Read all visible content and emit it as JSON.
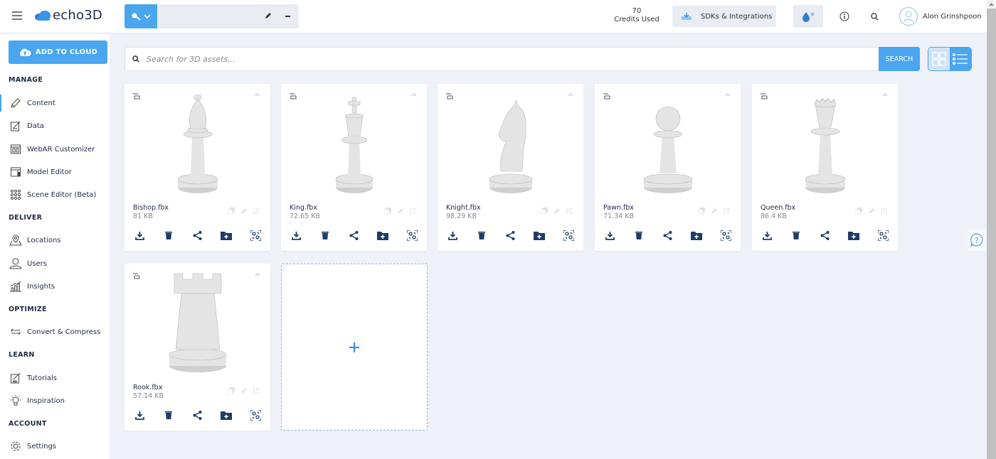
{
  "app": {
    "logo_text": "echo3D"
  },
  "topbar": {
    "credits_value": "70",
    "credits_label": "Credits Used",
    "sdk_button": "SDKs & Integrations",
    "user_name": "Alon Grinshpoon"
  },
  "sidebar": {
    "add_button": "ADD TO CLOUD",
    "sections": [
      {
        "title": "MANAGE",
        "items": [
          {
            "label": "Content",
            "icon": "pencil-icon",
            "active": true
          },
          {
            "label": "Data",
            "icon": "data-form-icon"
          },
          {
            "label": "WebAR Customizer",
            "icon": "webar-icon"
          },
          {
            "label": "Model Editor",
            "icon": "model-editor-icon"
          },
          {
            "label": "Scene Editor (Beta)",
            "icon": "dots-grid-icon"
          }
        ]
      },
      {
        "title": "DELIVER",
        "items": [
          {
            "label": "Locations",
            "icon": "location-pin-icon"
          },
          {
            "label": "Users",
            "icon": "user-icon"
          },
          {
            "label": "Insights",
            "icon": "chart-icon"
          }
        ]
      },
      {
        "title": "OPTIMIZE",
        "items": [
          {
            "label": "Convert & Compress",
            "icon": "convert-arrows-icon"
          }
        ]
      },
      {
        "title": "LEARN",
        "items": [
          {
            "label": "Tutorials",
            "icon": "tutorial-icon"
          },
          {
            "label": "Inspiration",
            "icon": "lightbulb-icon"
          }
        ]
      },
      {
        "title": "ACCOUNT",
        "items": [
          {
            "label": "Settings",
            "icon": "gear-icon"
          }
        ]
      }
    ]
  },
  "search": {
    "placeholder": "Search for 3D assets...",
    "value": "",
    "button": "SEARCH"
  },
  "assets": [
    {
      "name": "Bishop.fbx",
      "size": "81 KB",
      "piece": "bishop"
    },
    {
      "name": "King.fbx",
      "size": "72.65 KB",
      "piece": "king"
    },
    {
      "name": "Knight.fbx",
      "size": "98.29 KB",
      "piece": "knight"
    },
    {
      "name": "Pawn.fbx",
      "size": "71.34 KB",
      "piece": "pawn"
    },
    {
      "name": "Queen.fbx",
      "size": "86.4 KB",
      "piece": "queen"
    },
    {
      "name": "Rook.fbx",
      "size": "57.14 KB",
      "piece": "rook"
    }
  ],
  "colors": {
    "accent": "#4aa6ee",
    "navy": "#1f2a44",
    "background": "#eef1f8"
  }
}
